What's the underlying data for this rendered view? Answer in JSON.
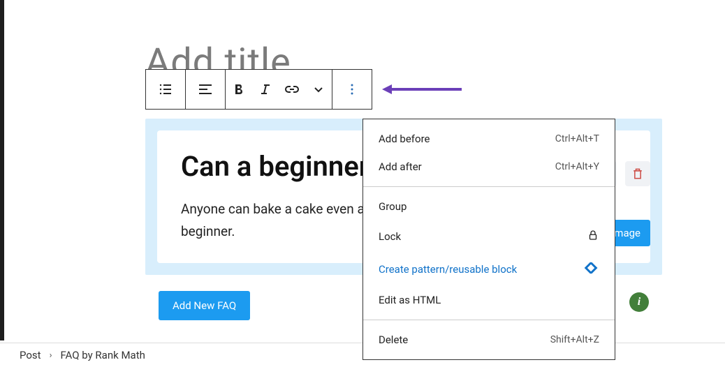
{
  "title_placeholder": "Add title",
  "faq": {
    "question": "Can a beginner bake a cake?",
    "answer_line1": "Anyone can bake a cake even a",
    "answer_line2": "beginner.",
    "add_button": "Add New FAQ",
    "upload_button": "Upload Image"
  },
  "dropdown": {
    "add_before": {
      "label": "Add before",
      "shortcut": "Ctrl+Alt+T"
    },
    "add_after": {
      "label": "Add after",
      "shortcut": "Ctrl+Alt+Y"
    },
    "group": "Group",
    "lock": "Lock",
    "create_pattern": "Create pattern/reusable block",
    "edit_html": "Edit as HTML",
    "delete": {
      "label": "Delete",
      "shortcut": "Shift+Alt+Z"
    }
  },
  "breadcrumb": {
    "post": "Post",
    "block": "FAQ by Rank Math"
  }
}
